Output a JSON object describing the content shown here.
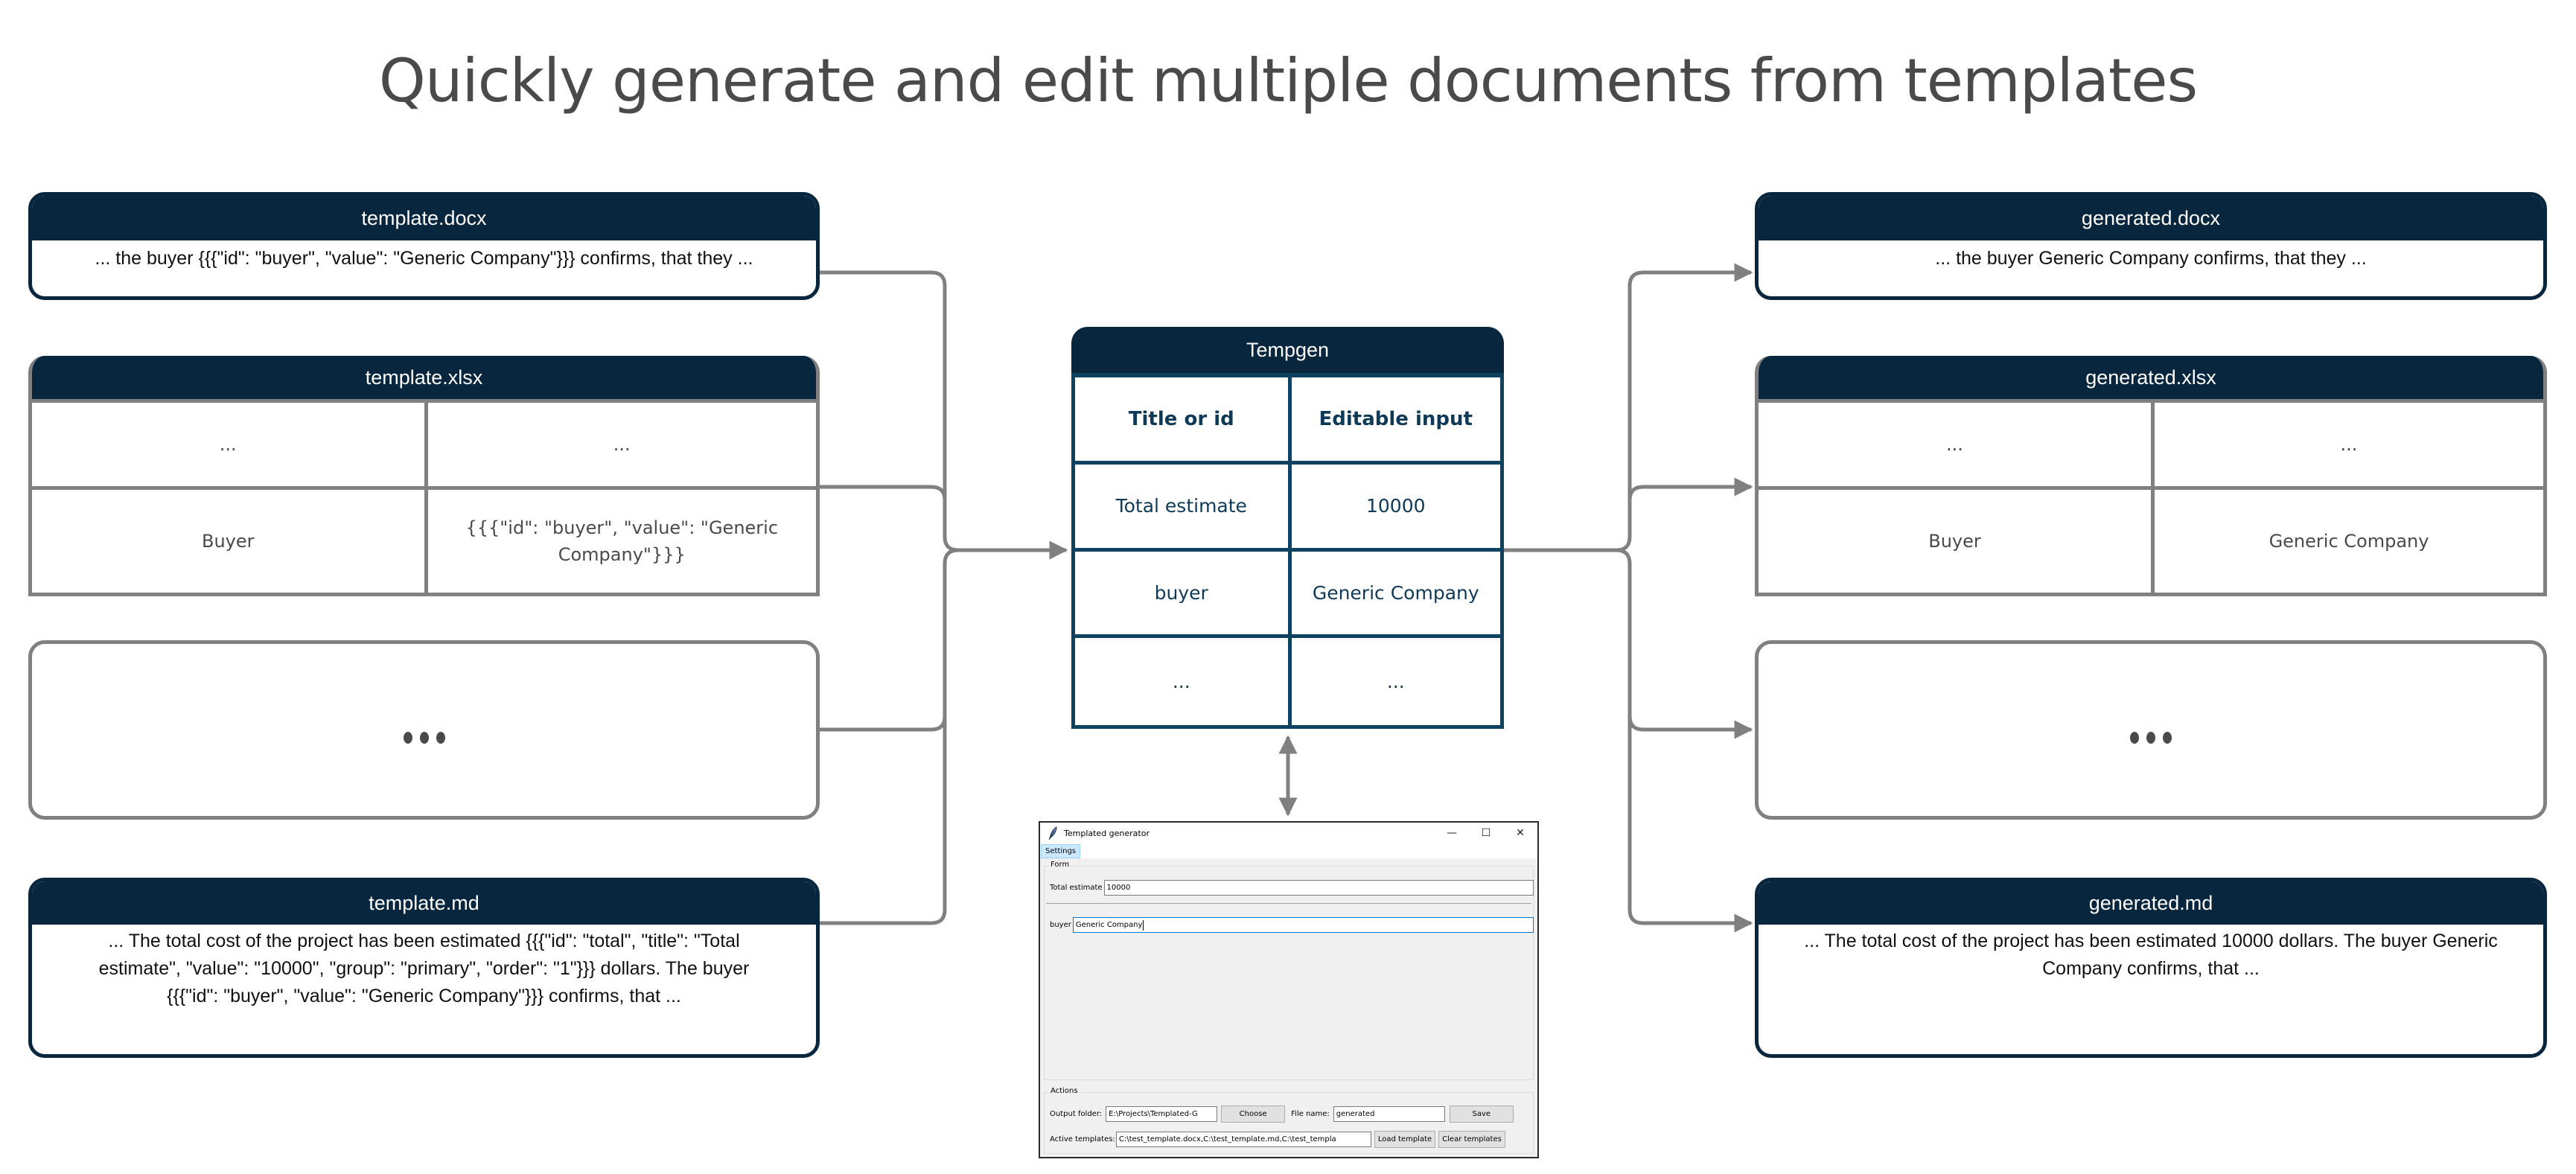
{
  "page": {
    "title": "Quickly generate and edit multiple documents from templates"
  },
  "colors": {
    "header_navy": "#08263d",
    "table_blue": "#0f4261",
    "connector_gray": "#808080",
    "title_gray": "#4a4a4a",
    "focus_blue": "#0078d7"
  },
  "templates": {
    "docx": {
      "title": "template.docx",
      "body": "... the buyer {{{\"id\": \"buyer\", \"value\": \"Generic Company\"}}} confirms, that they ..."
    },
    "xlsx": {
      "title": "template.xlsx",
      "rows": [
        [
          "...",
          "..."
        ],
        [
          "Buyer",
          "{{{\"id\": \"buyer\", \"value\": \"Generic Company\"}}}"
        ]
      ]
    },
    "more": {
      "icon": "ellipsis-icon"
    },
    "md": {
      "title": "template.md",
      "body": "... The total cost of the project has been estimated {{{\"id\": \"total\", \"title\": \"Total estimate\", \"value\": \"10000\", \"group\": \"primary\", \"order\": \"1\"}}} dollars. The buyer {{{\"id\": \"buyer\", \"value\": \"Generic Company\"}}} confirms, that ..."
    }
  },
  "tempgen": {
    "title": "Tempgen",
    "headers": [
      "Title or id",
      "Editable input"
    ],
    "rows": [
      [
        "Total estimate",
        "10000"
      ],
      [
        "buyer",
        "Generic Company"
      ],
      [
        "...",
        "..."
      ]
    ]
  },
  "generated": {
    "docx": {
      "title": "generated.docx",
      "body": "... the buyer Generic Company confirms, that they ..."
    },
    "xlsx": {
      "title": "generated.xlsx",
      "rows": [
        [
          "...",
          "..."
        ],
        [
          "Buyer",
          "Generic Company"
        ]
      ]
    },
    "more": {
      "icon": "ellipsis-icon"
    },
    "md": {
      "title": "generated.md",
      "body": "... The total cost of the project has been estimated 10000 dollars. The buyer Generic Company confirms, that ..."
    }
  },
  "app": {
    "window_title": "Templated generator",
    "window_icon": "feather-icon",
    "controls": {
      "minimize": "—",
      "maximize": "☐",
      "close": "✕"
    },
    "menu": [
      "Settings"
    ],
    "form": {
      "label": "Form",
      "fields": [
        {
          "label": "Total estimate",
          "value": "10000"
        },
        {
          "label": "buyer",
          "value": "Generic Company"
        }
      ]
    },
    "actions": {
      "label": "Actions",
      "output_folder_label": "Output folder:",
      "output_folder_value": "E:\\Projects\\Templated-G",
      "choose_button": "Choose",
      "file_name_label": "File name:",
      "file_name_value": "generated",
      "save_button": "Save",
      "active_templates_label": "Active templates:",
      "active_templates_value": "C:\\test_template.docx,C:\\test_template.md,C:\\test_templa",
      "load_template_button": "Load template",
      "clear_templates_button": "Clear templates"
    }
  }
}
